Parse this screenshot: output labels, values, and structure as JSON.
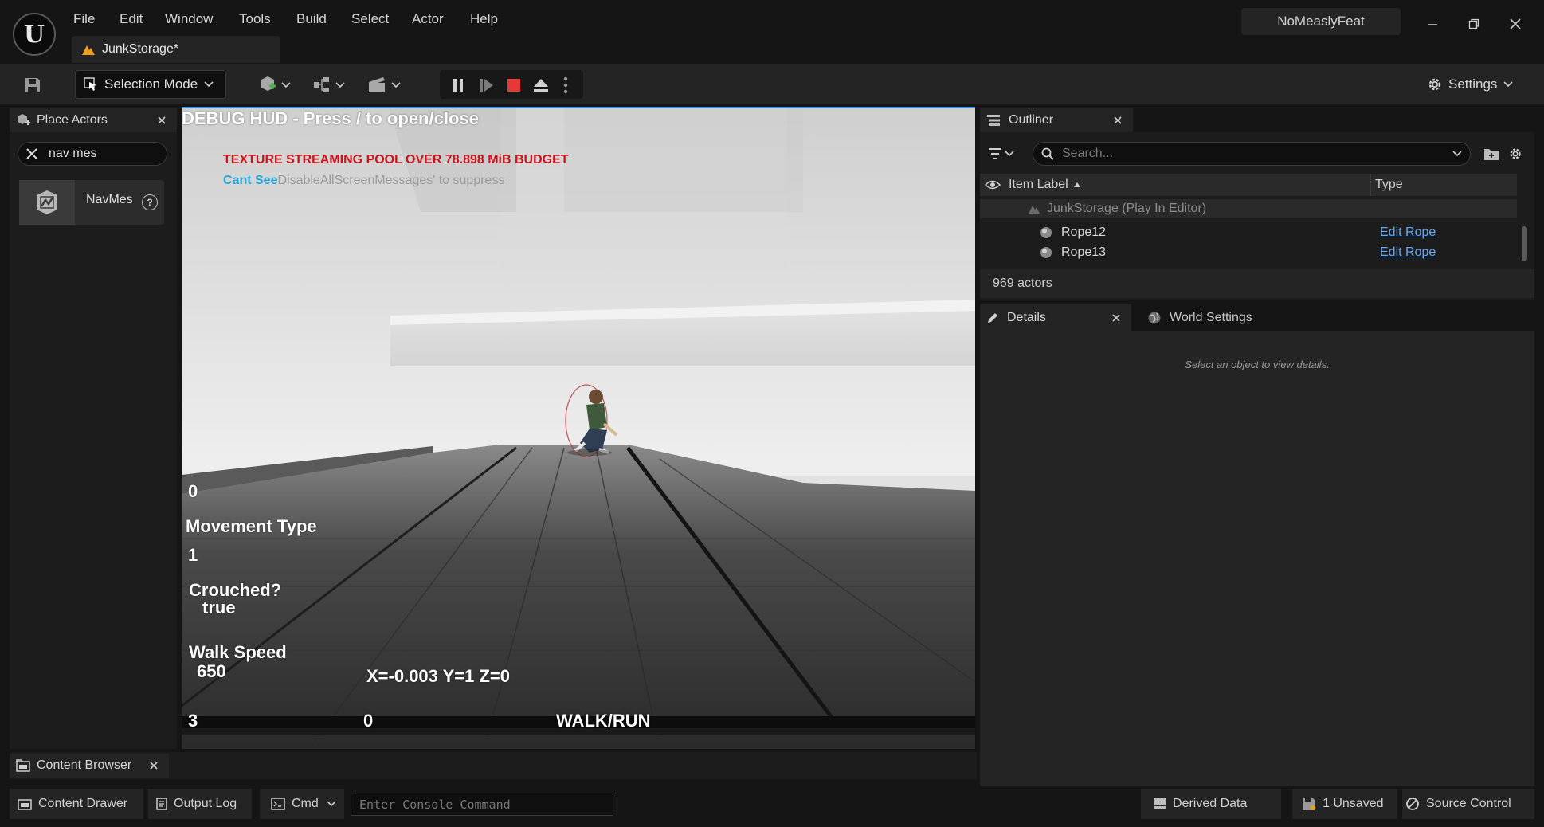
{
  "app": {
    "menu": [
      "File",
      "Edit",
      "Window",
      "Tools",
      "Build",
      "Select",
      "Actor",
      "Help"
    ],
    "document_tab": "JunkStorage*",
    "project_name": "NoMeaslyFeat"
  },
  "toolbar": {
    "selection_mode": "Selection Mode",
    "settings": "Settings"
  },
  "place_actors": {
    "title": "Place Actors",
    "search_value": "nav mes",
    "items": [
      {
        "label": "NavMes"
      }
    ]
  },
  "viewport": {
    "debug_title": "DEBUG HUD - Press / to open/close",
    "warning": "TEXTURE STREAMING POOL OVER 78.898 MiB BUDGET",
    "cant_see": "Cant See",
    "suppress_hint": "DisableAllScreenMessages' to suppress",
    "hud": {
      "zero_top": "0",
      "movement_type_label": "Movement Type",
      "movement_type_value": "1",
      "crouched_label": "Crouched?",
      "crouched_value": "true",
      "walk_speed_label": "Walk Speed",
      "walk_speed_value": "650",
      "coords": "X=-0.003 Y=1 Z=0",
      "bottom_left": "3",
      "bottom_mid": "0",
      "mode": "WALK/RUN"
    }
  },
  "outliner": {
    "title": "Outliner",
    "search_placeholder": "Search...",
    "col_label": "Item Label",
    "col_type": "Type",
    "root": "JunkStorage (Play In Editor)",
    "rows": [
      {
        "label": "Rope12",
        "type": "Edit Rope"
      },
      {
        "label": "Rope13",
        "type": "Edit Rope"
      }
    ],
    "actor_count": "969 actors"
  },
  "details": {
    "title": "Details",
    "world_settings": "World Settings",
    "empty_message": "Select an object to view details."
  },
  "content_browser": {
    "title": "Content Browser"
  },
  "statusbar": {
    "content_drawer": "Content Drawer",
    "output_log": "Output Log",
    "cmd": "Cmd",
    "console_placeholder": "Enter Console Command",
    "derived_data": "Derived Data",
    "unsaved": "1 Unsaved",
    "source_control": "Source Control"
  },
  "colors": {
    "accent": "#3b8ee8",
    "warning_red": "#c8141c",
    "link_blue": "#6aa8f0",
    "cyan_text": "#22a8d8",
    "stop_red": "#e53935"
  }
}
